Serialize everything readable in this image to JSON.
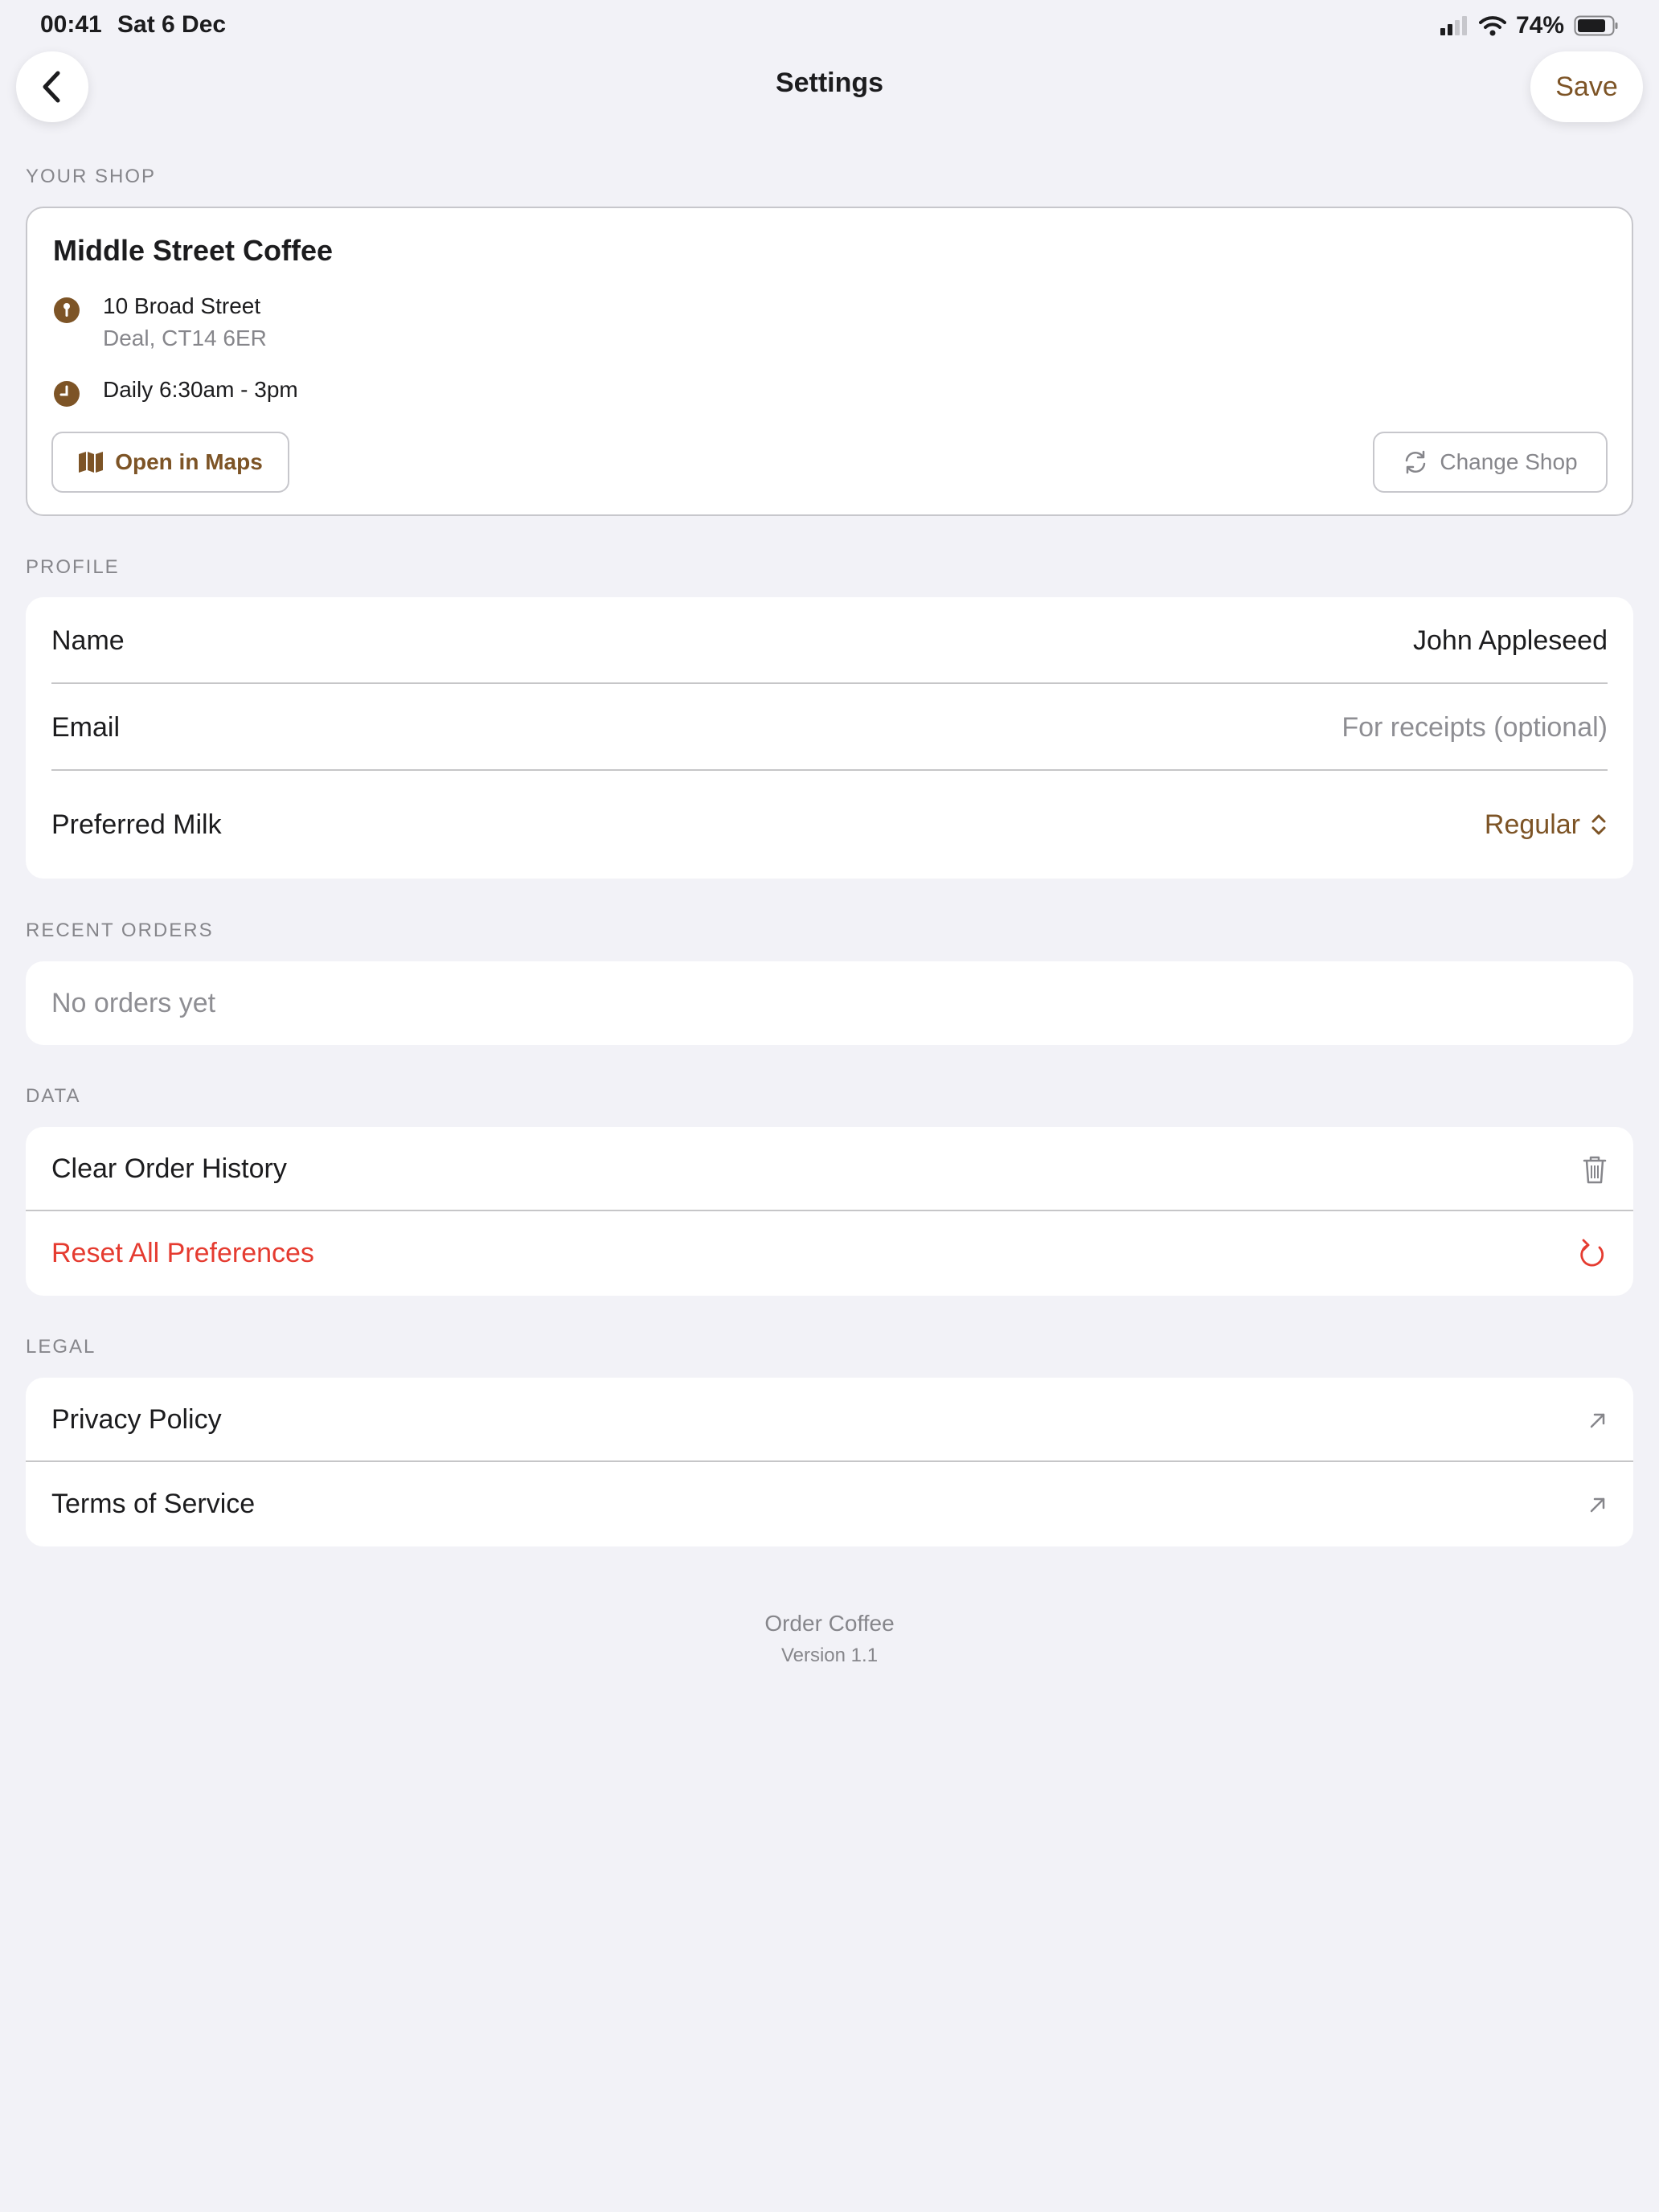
{
  "status_bar": {
    "time": "00:41",
    "date": "Sat 6 Dec",
    "battery_pct": "74%"
  },
  "nav": {
    "title": "Settings",
    "save_label": "Save"
  },
  "sections": {
    "your_shop": "YOUR SHOP",
    "profile": "PROFILE",
    "recent_orders": "RECENT ORDERS",
    "data": "DATA",
    "legal": "LEGAL"
  },
  "shop": {
    "name": "Middle Street Coffee",
    "address_line1": "10 Broad Street",
    "address_line2": "Deal, CT14 6ER",
    "hours": "Daily 6:30am - 3pm",
    "open_maps_label": "Open in Maps",
    "change_shop_label": "Change Shop"
  },
  "profile": {
    "name_label": "Name",
    "name_value": "John Appleseed",
    "email_label": "Email",
    "email_placeholder": "For receipts (optional)",
    "milk_label": "Preferred Milk",
    "milk_value": "Regular"
  },
  "recent_orders": {
    "empty_text": "No orders yet"
  },
  "data_section": {
    "clear_history": "Clear Order History",
    "reset_prefs": "Reset All Preferences"
  },
  "legal": {
    "privacy": "Privacy Policy",
    "terms": "Terms of Service"
  },
  "footer": {
    "app_name": "Order Coffee",
    "version": "Version 1.1"
  },
  "colors": {
    "background": "#f2f2f7",
    "accent_brown": "#7d5426",
    "destructive": "#e53b30",
    "secondary_text": "#86868b"
  }
}
